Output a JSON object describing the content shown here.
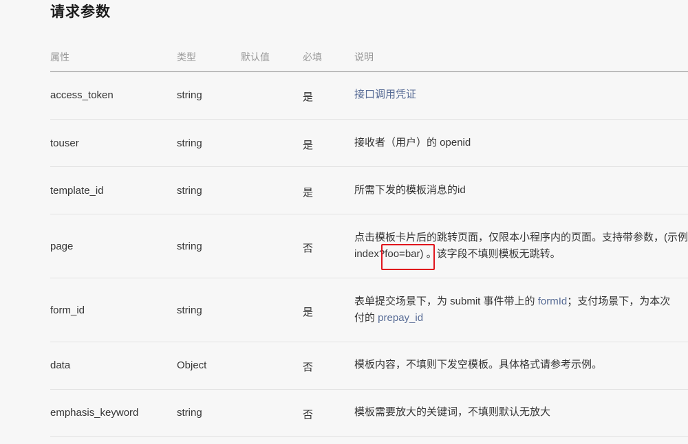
{
  "page_title": "请求参数",
  "columns": [
    "属性",
    "类型",
    "默认值",
    "必填",
    "说明"
  ],
  "rows": [
    {
      "name": "access_token",
      "type": "string",
      "required": "是",
      "desc_link": "接口调用凭证"
    },
    {
      "name": "touser",
      "type": "string",
      "required": "是",
      "desc": "接收者（用户）的 openid"
    },
    {
      "name": "template_id",
      "type": "string",
      "required": "是",
      "desc": "所需下发的模板消息的id"
    },
    {
      "name": "page",
      "type": "string",
      "required": "否",
      "desc_line1": "点击模板卡片后的跳转页面，仅限本小程序内的页面。支持带参数，(示例",
      "desc_line2_a": "index",
      "desc_line2_b": "?foo=bar)",
      "desc_line2_c": "。该字段不填则模板无跳转。"
    },
    {
      "name": "form_id",
      "type": "string",
      "required": "是",
      "desc_line1_a": "表单提交场景下，为 submit 事件带上的 ",
      "desc_line1_link": "formId",
      "desc_line1_b": "；支付场景下，为本次",
      "desc_line2_a": "付的 ",
      "desc_line2_link": "prepay_id"
    },
    {
      "name": "data",
      "type": "Object",
      "required": "否",
      "desc": "模板内容，不填则下发空模板。具体格式请参考示例。"
    },
    {
      "name": "emphasis_keyword",
      "type": "string",
      "required": "否",
      "desc": "模板需要放大的关键词，不填则默认无放大"
    }
  ],
  "colors": {
    "link": "#576b95",
    "highlight": "#e0141c"
  }
}
